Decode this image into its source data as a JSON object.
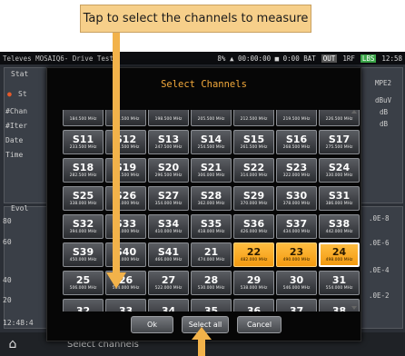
{
  "callout": {
    "text": "Tap to select the channels to measure"
  },
  "statusbar": {
    "app_title": "Televes MOSAIQ6- Drive Test",
    "center_text": "8% ▲ 00:00:00 ■ 0:00 BAT",
    "badge_out": "OUT",
    "badge_1rf": "1RF",
    "badge_lbs": "LBS",
    "time": "12:58"
  },
  "background": {
    "stat_label": "Stat",
    "st_label": "St",
    "chan_label": "#Chan",
    "iter_label": "#Iter",
    "date_label": "Date",
    "time_label": "Time",
    "evol_label": "Evol",
    "y80": "80",
    "y60": "60",
    "y40": "40",
    "y20": "20",
    "bottom_time": "12:48:4",
    "right_mpe2": "MPE2",
    "right_dbuv": "dBuV",
    "right_db1": "dB",
    "right_db2": "dB",
    "right_exp1": ".0E-8",
    "right_exp2": ".0E-6",
    "right_exp3": ".0E-4",
    "right_exp4": ".0E-2"
  },
  "bottombar": {
    "label": "Select channels"
  },
  "dialog": {
    "title": "Select Channels",
    "ok_label": "Ok",
    "select_all_label": "Select all",
    "cancel_label": "Cancel",
    "partial_top_freqs": [
      "184.500 MHz",
      "191.500 MHz",
      "198.500 MHz",
      "205.500 MHz",
      "212.500 MHz",
      "219.500 MHz",
      "226.500 MHz"
    ],
    "rows": [
      [
        {
          "name": "S11",
          "freq": "233.500 MHz",
          "selected": false
        },
        {
          "name": "S12",
          "freq": "240.500 MHz",
          "selected": false
        },
        {
          "name": "S13",
          "freq": "247.500 MHz",
          "selected": false
        },
        {
          "name": "S14",
          "freq": "254.500 MHz",
          "selected": false
        },
        {
          "name": "S15",
          "freq": "261.500 MHz",
          "selected": false
        },
        {
          "name": "S16",
          "freq": "268.500 MHz",
          "selected": false
        },
        {
          "name": "S17",
          "freq": "275.500 MHz",
          "selected": false
        }
      ],
      [
        {
          "name": "S18",
          "freq": "282.500 MHz",
          "selected": false
        },
        {
          "name": "S19",
          "freq": "289.500 MHz",
          "selected": false
        },
        {
          "name": "S20",
          "freq": "296.500 MHz",
          "selected": false
        },
        {
          "name": "S21",
          "freq": "306.000 MHz",
          "selected": false
        },
        {
          "name": "S22",
          "freq": "314.000 MHz",
          "selected": false
        },
        {
          "name": "S23",
          "freq": "322.000 MHz",
          "selected": false
        },
        {
          "name": "S24",
          "freq": "330.000 MHz",
          "selected": false
        }
      ],
      [
        {
          "name": "S25",
          "freq": "338.000 MHz",
          "selected": false
        },
        {
          "name": "S26",
          "freq": "346.000 MHz",
          "selected": false
        },
        {
          "name": "S27",
          "freq": "354.000 MHz",
          "selected": false
        },
        {
          "name": "S28",
          "freq": "362.000 MHz",
          "selected": false
        },
        {
          "name": "S29",
          "freq": "370.000 MHz",
          "selected": false
        },
        {
          "name": "S30",
          "freq": "378.000 MHz",
          "selected": false
        },
        {
          "name": "S31",
          "freq": "386.000 MHz",
          "selected": false
        }
      ],
      [
        {
          "name": "S32",
          "freq": "394.000 MHz",
          "selected": false
        },
        {
          "name": "S33",
          "freq": "402.000 MHz",
          "selected": false
        },
        {
          "name": "S34",
          "freq": "410.000 MHz",
          "selected": false
        },
        {
          "name": "S35",
          "freq": "418.000 MHz",
          "selected": false
        },
        {
          "name": "S36",
          "freq": "426.000 MHz",
          "selected": false
        },
        {
          "name": "S37",
          "freq": "434.000 MHz",
          "selected": false
        },
        {
          "name": "S38",
          "freq": "442.000 MHz",
          "selected": false
        }
      ],
      [
        {
          "name": "S39",
          "freq": "450.000 MHz",
          "selected": false
        },
        {
          "name": "S40",
          "freq": "458.000 MHz",
          "selected": false
        },
        {
          "name": "S41",
          "freq": "466.000 MHz",
          "selected": false
        },
        {
          "name": "21",
          "freq": "474.000 MHz",
          "selected": false
        },
        {
          "name": "22",
          "freq": "482.000 MHz",
          "selected": true
        },
        {
          "name": "23",
          "freq": "490.000 MHz",
          "selected": true
        },
        {
          "name": "24",
          "freq": "498.000 MHz",
          "selected": true,
          "focused": true
        }
      ],
      [
        {
          "name": "25",
          "freq": "506.000 MHz",
          "selected": false
        },
        {
          "name": "26",
          "freq": "514.000 MHz",
          "selected": false
        },
        {
          "name": "27",
          "freq": "522.000 MHz",
          "selected": false
        },
        {
          "name": "28",
          "freq": "530.000 MHz",
          "selected": false
        },
        {
          "name": "29",
          "freq": "538.000 MHz",
          "selected": false
        },
        {
          "name": "30",
          "freq": "546.000 MHz",
          "selected": false
        },
        {
          "name": "31",
          "freq": "554.000 MHz",
          "selected": false
        }
      ],
      [
        {
          "name": "32",
          "freq": "",
          "selected": false
        },
        {
          "name": "33",
          "freq": "",
          "selected": false
        },
        {
          "name": "34",
          "freq": "",
          "selected": false
        },
        {
          "name": "35",
          "freq": "",
          "selected": false
        },
        {
          "name": "36",
          "freq": "",
          "selected": false
        },
        {
          "name": "37",
          "freq": "",
          "selected": false
        },
        {
          "name": "38",
          "freq": "",
          "selected": false
        }
      ]
    ]
  },
  "colors": {
    "accent_orange": "#f2a93b",
    "selected_fill": "#f6a623",
    "callout_fill": "#f6cf8a",
    "arrow": "#f2b24a"
  }
}
